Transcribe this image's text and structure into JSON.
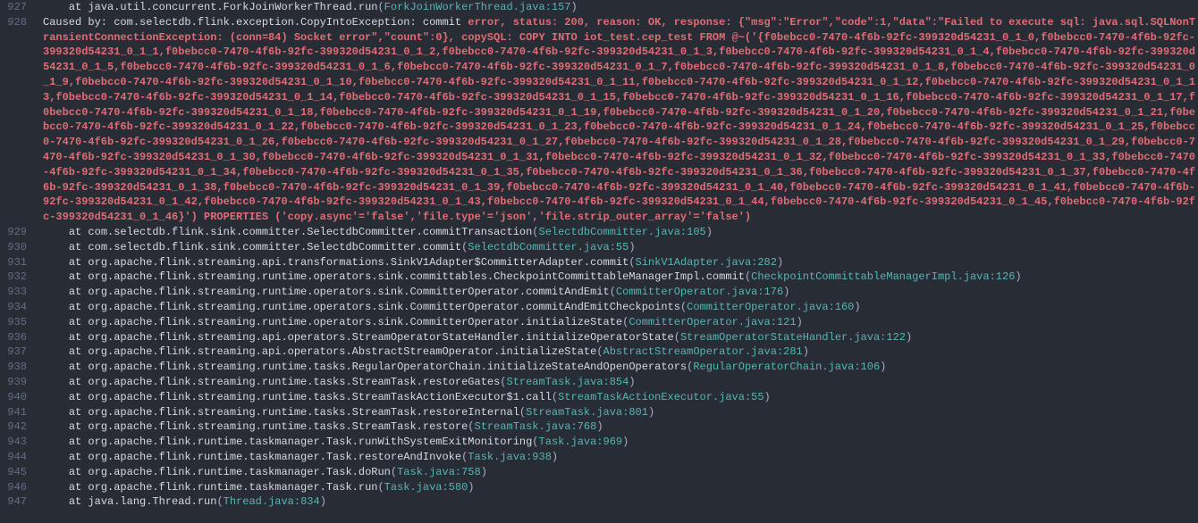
{
  "lines": [
    {
      "num": "927",
      "prefix": "    at java.util.concurrent.ForkJoinWorkerThread.run",
      "link": "ForkJoinWorkerThread.java:157",
      "type": "stack"
    },
    {
      "num": "928",
      "type": "error",
      "prefix_white": "Caused by: com.selectdb.flink.exception.CopyIntoException: commit ",
      "error_text": "error, status: 200, reason: OK, response: {\"msg\":\"Error\",\"code\":1,\"data\":\"Failed to execute sql: java.sql.SQLNonTransientConnectionException: (conn=84) Socket error\",\"count\":0}, copySQL: COPY INTO iot_test.cep_test FROM @~('{f0bebcc0-7470-4f6b-92fc-399320d54231_0_1_0,f0bebcc0-7470-4f6b-92fc-399320d54231_0_1_1,f0bebcc0-7470-4f6b-92fc-399320d54231_0_1_2,f0bebcc0-7470-4f6b-92fc-399320d54231_0_1_3,f0bebcc0-7470-4f6b-92fc-399320d54231_0_1_4,f0bebcc0-7470-4f6b-92fc-399320d54231_0_1_5,f0bebcc0-7470-4f6b-92fc-399320d54231_0_1_6,f0bebcc0-7470-4f6b-92fc-399320d54231_0_1_7,f0bebcc0-7470-4f6b-92fc-399320d54231_0_1_8,f0bebcc0-7470-4f6b-92fc-399320d54231_0_1_9,f0bebcc0-7470-4f6b-92fc-399320d54231_0_1_10,f0bebcc0-7470-4f6b-92fc-399320d54231_0_1_11,f0bebcc0-7470-4f6b-92fc-399320d54231_0_1_12,f0bebcc0-7470-4f6b-92fc-399320d54231_0_1_13,f0bebcc0-7470-4f6b-92fc-399320d54231_0_1_14,f0bebcc0-7470-4f6b-92fc-399320d54231_0_1_15,f0bebcc0-7470-4f6b-92fc-399320d54231_0_1_16,f0bebcc0-7470-4f6b-92fc-399320d54231_0_1_17,f0bebcc0-7470-4f6b-92fc-399320d54231_0_1_18,f0bebcc0-7470-4f6b-92fc-399320d54231_0_1_19,f0bebcc0-7470-4f6b-92fc-399320d54231_0_1_20,f0bebcc0-7470-4f6b-92fc-399320d54231_0_1_21,f0bebcc0-7470-4f6b-92fc-399320d54231_0_1_22,f0bebcc0-7470-4f6b-92fc-399320d54231_0_1_23,f0bebcc0-7470-4f6b-92fc-399320d54231_0_1_24,f0bebcc0-7470-4f6b-92fc-399320d54231_0_1_25,f0bebcc0-7470-4f6b-92fc-399320d54231_0_1_26,f0bebcc0-7470-4f6b-92fc-399320d54231_0_1_27,f0bebcc0-7470-4f6b-92fc-399320d54231_0_1_28,f0bebcc0-7470-4f6b-92fc-399320d54231_0_1_29,f0bebcc0-7470-4f6b-92fc-399320d54231_0_1_30,f0bebcc0-7470-4f6b-92fc-399320d54231_0_1_31,f0bebcc0-7470-4f6b-92fc-399320d54231_0_1_32,f0bebcc0-7470-4f6b-92fc-399320d54231_0_1_33,f0bebcc0-7470-4f6b-92fc-399320d54231_0_1_34,f0bebcc0-7470-4f6b-92fc-399320d54231_0_1_35,f0bebcc0-7470-4f6b-92fc-399320d54231_0_1_36,f0bebcc0-7470-4f6b-92fc-399320d54231_0_1_37,f0bebcc0-7470-4f6b-92fc-399320d54231_0_1_38,f0bebcc0-7470-4f6b-92fc-399320d54231_0_1_39,f0bebcc0-7470-4f6b-92fc-399320d54231_0_1_40,f0bebcc0-7470-4f6b-92fc-399320d54231_0_1_41,f0bebcc0-7470-4f6b-92fc-399320d54231_0_1_42,f0bebcc0-7470-4f6b-92fc-399320d54231_0_1_43,f0bebcc0-7470-4f6b-92fc-399320d54231_0_1_44,f0bebcc0-7470-4f6b-92fc-399320d54231_0_1_45,f0bebcc0-7470-4f6b-92fc-399320d54231_0_1_46}') PROPERTIES ('copy.async'='false','file.type'='json','file.strip_outer_array'='false')"
    },
    {
      "num": "929",
      "prefix": "    at com.selectdb.flink.sink.committer.SelectdbCommitter.commitTransaction",
      "link": "SelectdbCommitter.java:105",
      "type": "stack"
    },
    {
      "num": "930",
      "prefix": "    at com.selectdb.flink.sink.committer.SelectdbCommitter.commit",
      "link": "SelectdbCommitter.java:55",
      "type": "stack"
    },
    {
      "num": "931",
      "prefix": "    at org.apache.flink.streaming.api.transformations.SinkV1Adapter$CommitterAdapter.commit",
      "link": "SinkV1Adapter.java:282",
      "type": "stack"
    },
    {
      "num": "932",
      "prefix": "    at org.apache.flink.streaming.runtime.operators.sink.committables.CheckpointCommittableManagerImpl.commit",
      "link": "CheckpointCommittableManagerImpl.java:126",
      "type": "stack"
    },
    {
      "num": "933",
      "prefix": "    at org.apache.flink.streaming.runtime.operators.sink.CommitterOperator.commitAndEmit",
      "link": "CommitterOperator.java:176",
      "type": "stack"
    },
    {
      "num": "934",
      "prefix": "    at org.apache.flink.streaming.runtime.operators.sink.CommitterOperator.commitAndEmitCheckpoints",
      "link": "CommitterOperator.java:160",
      "type": "stack"
    },
    {
      "num": "935",
      "prefix": "    at org.apache.flink.streaming.runtime.operators.sink.CommitterOperator.initializeState",
      "link": "CommitterOperator.java:121",
      "type": "stack"
    },
    {
      "num": "936",
      "prefix": "    at org.apache.flink.streaming.api.operators.StreamOperatorStateHandler.initializeOperatorState",
      "link": "StreamOperatorStateHandler.java:122",
      "type": "stack"
    },
    {
      "num": "937",
      "prefix": "    at org.apache.flink.streaming.api.operators.AbstractStreamOperator.initializeState",
      "link": "AbstractStreamOperator.java:281",
      "type": "stack"
    },
    {
      "num": "938",
      "prefix": "    at org.apache.flink.streaming.runtime.tasks.RegularOperatorChain.initializeStateAndOpenOperators",
      "link": "RegularOperatorChain.java:106",
      "type": "stack"
    },
    {
      "num": "939",
      "prefix": "    at org.apache.flink.streaming.runtime.tasks.StreamTask.restoreGates",
      "link": "StreamTask.java:854",
      "type": "stack"
    },
    {
      "num": "940",
      "prefix": "    at org.apache.flink.streaming.runtime.tasks.StreamTaskActionExecutor$1.call",
      "link": "StreamTaskActionExecutor.java:55",
      "type": "stack"
    },
    {
      "num": "941",
      "prefix": "    at org.apache.flink.streaming.runtime.tasks.StreamTask.restoreInternal",
      "link": "StreamTask.java:801",
      "type": "stack"
    },
    {
      "num": "942",
      "prefix": "    at org.apache.flink.streaming.runtime.tasks.StreamTask.restore",
      "link": "StreamTask.java:768",
      "type": "stack"
    },
    {
      "num": "943",
      "prefix": "    at org.apache.flink.runtime.taskmanager.Task.runWithSystemExitMonitoring",
      "link": "Task.java:969",
      "type": "stack"
    },
    {
      "num": "944",
      "prefix": "    at org.apache.flink.runtime.taskmanager.Task.restoreAndInvoke",
      "link": "Task.java:938",
      "type": "stack"
    },
    {
      "num": "945",
      "prefix": "    at org.apache.flink.runtime.taskmanager.Task.doRun",
      "link": "Task.java:758",
      "type": "stack"
    },
    {
      "num": "946",
      "prefix": "    at org.apache.flink.runtime.taskmanager.Task.run",
      "link": "Task.java:580",
      "type": "stack"
    },
    {
      "num": "947",
      "prefix": "    at java.lang.Thread.run",
      "link": "Thread.java:834",
      "type": "stack"
    }
  ]
}
